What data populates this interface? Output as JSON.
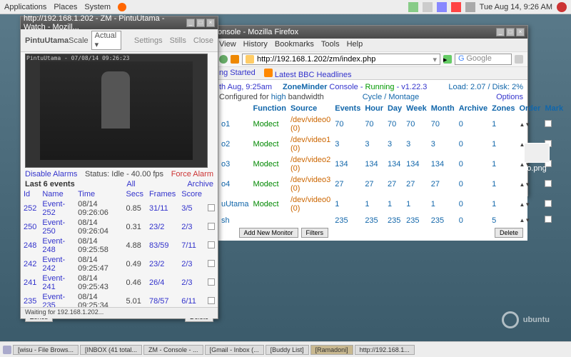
{
  "menubar": {
    "apps": [
      "Applications",
      "Places",
      "System"
    ],
    "clock": "Tue Aug 14,  9:26 AM"
  },
  "watch": {
    "titlebar": "http://192.168.1.202 - ZM - PintuUtama - Watch - Mozill...",
    "name": "PintuUtama",
    "scale_label": "Scale",
    "scale_value": "Actual",
    "settings": "Settings",
    "stills": "Stills",
    "close": "Close",
    "cam_overlay": "PintuUtama - 07/08/14 09:26:23",
    "disable": "Disable Alarms",
    "status": "Status: Idle - 40.00 fps",
    "force": "Force Alarm",
    "last6": "Last 6 events",
    "all": "All",
    "archive": "Archive",
    "cols": [
      "Id",
      "Name",
      "Time",
      "Secs",
      "Frames",
      "Score",
      ""
    ],
    "rows": [
      [
        "252",
        "Event-252",
        "08/14 09:26:06",
        "0.85",
        "31/11",
        "3/5"
      ],
      [
        "250",
        "Event-250",
        "08/14 09:26:04",
        "0.31",
        "23/2",
        "2/3"
      ],
      [
        "248",
        "Event-248",
        "08/14 09:25:58",
        "4.88",
        "83/59",
        "7/11"
      ],
      [
        "242",
        "Event-242",
        "08/14 09:25:47",
        "0.49",
        "23/2",
        "2/3"
      ],
      [
        "241",
        "Event-241",
        "08/14 09:25:43",
        "0.46",
        "26/4",
        "2/3"
      ],
      [
        "235",
        "Event-235",
        "08/14 09:25:34",
        "5.01",
        "78/57",
        "6/11"
      ]
    ],
    "zones_btn": "Zones",
    "delete_btn": "Delete",
    "statusbar": "Waiting for 192.168.1.202..."
  },
  "ff": {
    "titlebar": "onsole - Mozilla Firefox",
    "menu": [
      "View",
      "History",
      "Bookmarks",
      "Tools",
      "Help"
    ],
    "url": "http://192.168.1.202/zm/index.php",
    "search_placeholder": "Google",
    "links": [
      "ng Started",
      "Latest BBC Headlines"
    ]
  },
  "zm": {
    "datetime": "th Aug, 9:25am",
    "title1": "ZoneMinder ",
    "title2": "Console - ",
    "running": "Running",
    "ver": " - v1.22.3",
    "load": "Load: 2.07 / Disk: 2%",
    "configured": "Configured for ",
    "high": "high",
    "bandwidth": " bandwidth",
    "cycle": "Cycle / Montage",
    "options": "Options",
    "cols": [
      "",
      "Function",
      "Source",
      "Events",
      "Hour",
      "Day",
      "Week",
      "Month",
      "Archive",
      "Zones",
      "Order",
      "Mark"
    ],
    "rows": [
      [
        "o1",
        "Modect",
        "/dev/video0 (0)",
        "70",
        "70",
        "70",
        "70",
        "70",
        "0",
        "1"
      ],
      [
        "o2",
        "Modect",
        "/dev/video1 (0)",
        "3",
        "3",
        "3",
        "3",
        "3",
        "0",
        "1"
      ],
      [
        "o3",
        "Modect",
        "/dev/video2 (0)",
        "134",
        "134",
        "134",
        "134",
        "134",
        "0",
        "1"
      ],
      [
        "o4",
        "Modect",
        "/dev/video3 (0)",
        "27",
        "27",
        "27",
        "27",
        "27",
        "0",
        "1"
      ],
      [
        "uUtama",
        "Modect",
        "/dev/video0 (0)",
        "1",
        "1",
        "1",
        "1",
        "1",
        "0",
        "1"
      ],
      [
        "sh",
        "",
        "",
        "235",
        "235",
        "235",
        "235",
        "235",
        "0",
        "5"
      ]
    ],
    "add_btn": "Add New Monitor",
    "filters_btn": "Filters",
    "delete_btn": "Delete"
  },
  "desktop_icon": "o.png",
  "ubuntu": "ubuntu",
  "taskbar": [
    "[wisu - File Brows...",
    "[INBOX (41 total...",
    "ZM - Console - ...",
    "[Gmail - Inbox (...",
    "[Buddy List]",
    "[Ramadoni]",
    "http://192.168.1..."
  ]
}
